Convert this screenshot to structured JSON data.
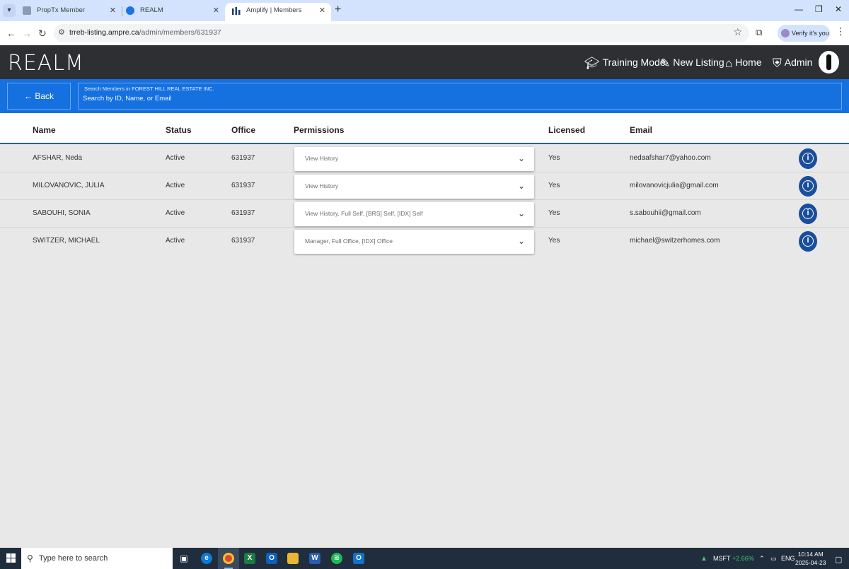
{
  "browser": {
    "tabs": [
      {
        "title": "PropTx Member",
        "active": false
      },
      {
        "title": "REALM",
        "active": false
      },
      {
        "title": "Amplify | Members",
        "active": true
      }
    ],
    "url_host": "trreb-listing.ampre.ca",
    "url_path": "/admin/members/631937",
    "verify_label": "Verify it's you"
  },
  "app": {
    "logo": "REALM",
    "nav": {
      "training": "Training Mode",
      "new_listing": "New Listing",
      "home": "Home",
      "admin": "Admin"
    }
  },
  "search": {
    "back_label": "Back",
    "legend": "Search Members in FOREST HILL REAL ESTATE INC.",
    "placeholder": "Search by ID, Name, or Email"
  },
  "table": {
    "headers": {
      "name": "Name",
      "status": "Status",
      "office": "Office",
      "permissions": "Permissions",
      "licensed": "Licensed",
      "email": "Email"
    },
    "rows": [
      {
        "name": "AFSHAR, Neda",
        "status": "Active",
        "office": "631937",
        "permissions": "View History",
        "licensed": "Yes",
        "email": "nedaafshar7@yahoo.com"
      },
      {
        "name": "MILOVANOVIC, JULIA",
        "status": "Active",
        "office": "631937",
        "permissions": "View History",
        "licensed": "Yes",
        "email": "milovanovicjulia@gmail.com"
      },
      {
        "name": "SABOUHI, SONIA",
        "status": "Active",
        "office": "631937",
        "permissions": "View History, Full Self, [BRS] Self, [IDX] Self",
        "licensed": "Yes",
        "email": "s.sabouhii@gmail.com"
      },
      {
        "name": "SWITZER, MICHAEL",
        "status": "Active",
        "office": "631937",
        "permissions": "Manager, Full Office, [IDX] Office",
        "licensed": "Yes",
        "email": "michael@switzerhomes.com"
      }
    ]
  },
  "taskbar": {
    "search_placeholder": "Type here to search",
    "stock_name": "MSFT",
    "stock_change": "+2.66%",
    "lang": "ENG",
    "time": "10:14 AM",
    "date": "2025-04-23"
  },
  "colors": {
    "header_bg": "#2d2f33",
    "search_band": "#1570e0",
    "info_button": "#1a4e9b",
    "stock_up": "#4cc26a"
  }
}
